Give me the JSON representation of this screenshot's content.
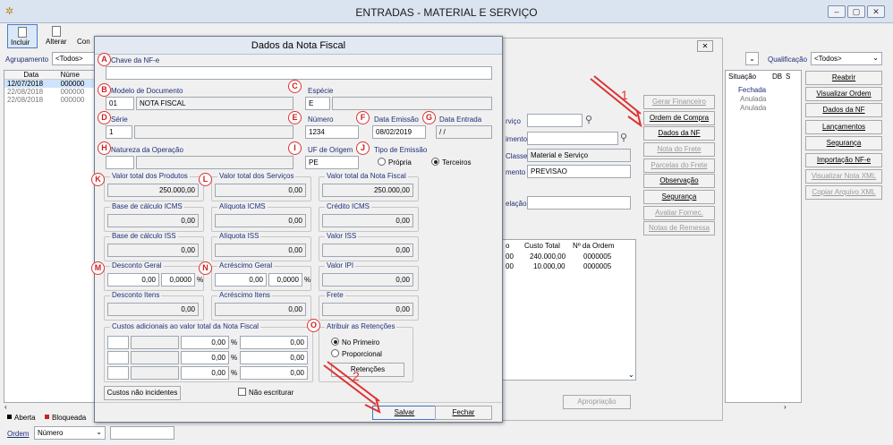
{
  "window": {
    "title": "ENTRADAS - MATERIAL E SERVIÇO",
    "min": "–",
    "max": "▢",
    "close": "✕"
  },
  "toolbar": {
    "incluir": "Incluir",
    "alterar": "Alterar",
    "consultar": "Con"
  },
  "filters": {
    "agrupamento_label": "Agrupamento",
    "agrupamento_value": "<Todos>",
    "qualificacao_label": "Qualificação",
    "qualificacao_value": "<Todos>"
  },
  "main_grid": {
    "headers": [
      "Data",
      "Núme"
    ],
    "rows": [
      [
        "12/07/2018",
        "000000"
      ],
      [
        "22/08/2018",
        "000000"
      ],
      [
        "22/08/2018",
        "000000"
      ]
    ]
  },
  "situacao": {
    "headers": [
      "Situação",
      "DB",
      "S"
    ],
    "rows": [
      "Fechada",
      "Anulada",
      "Anulada"
    ]
  },
  "right_buttons": [
    "Reabrir",
    "Visualizar Ordem",
    "Dados da NF",
    "Lançamentos",
    "Segurança",
    "Importação NF-e",
    "Visualizar Nota XML",
    "Copiar Arquivo XML"
  ],
  "bg_panel": {
    "buttons": [
      "Gerar Financeiro",
      "Ordem de Compra",
      "Dados da NF",
      "Nota do Frete",
      "Parcelas do Frete",
      "Observação",
      "Segurança",
      "Avaliar Fornec.",
      "Notas de Remessa"
    ],
    "labels": [
      "rviço",
      "imento",
      "Classe",
      "mento",
      "elação"
    ],
    "classe_value": "Material e Serviço",
    "doc_value": "PREVISAO",
    "close_x": "✕",
    "grid_headers": [
      "o",
      "Custo Total",
      "Nº da Ordem"
    ],
    "grid_rows": [
      [
        "00",
        "240.000,00",
        "0000005"
      ],
      [
        "00",
        "10.000,00",
        "0000005"
      ]
    ],
    "apropriacao": "Apropriação"
  },
  "legend": {
    "aberta": "Aberta",
    "bloqueada": "Bloqueada"
  },
  "bottom": {
    "ordem_label": "Ordem",
    "ordem_value": "Número"
  },
  "dialog": {
    "title": "Dados da Nota Fiscal",
    "chave_label": "Chave da NF-e",
    "chave_value": "",
    "modelo_label": "Modelo de Documento",
    "modelo_code": "01",
    "modelo_desc": "NOTA FISCAL",
    "especie_label": "Espécie",
    "especie_value": "E",
    "serie_label": "Série",
    "serie_value": "1",
    "numero_label": "Número",
    "numero_value": "1234",
    "emissao_label": "Data Emissão",
    "emissao_value": "08/02/2019",
    "entrada_label": "Data Entrada",
    "entrada_value": " / /",
    "natureza_label": "Natureza da Operação",
    "uf_label": "UF de Origem",
    "uf_value": "PE",
    "tipo_label": "Tipo de Emissão",
    "tipo_propria": "Própria",
    "tipo_terceiros": "Terceiros",
    "vprod_label": "Valor total dos Produtos",
    "vprod": "250.000,00",
    "vserv_label": "Valor total dos Serviços",
    "vserv": "0,00",
    "vnf_label": "Valor total da Nota Fiscal",
    "vnf": "250.000,00",
    "bicms_label": "Base de cálculo ICMS",
    "bicms": "0,00",
    "aicms_label": "Alíquota ICMS",
    "aicms": "0,00",
    "cicms_label": "Crédito ICMS",
    "cicms": "0,00",
    "biss_label": "Base de cálculo ISS",
    "biss": "0,00",
    "aiss_label": "Alíquota ISS",
    "aiss": "0,00",
    "viss_label": "Valor ISS",
    "viss": "0,00",
    "desc_label": "Desconto Geral",
    "desc": "0,00",
    "desc_pct": "0,0000",
    "acr_label": "Acréscimo Geral",
    "acr": "0,00",
    "acr_pct": "0,0000",
    "ipi_label": "Valor IPI",
    "ipi": "0,00",
    "desci_label": "Desconto Itens",
    "desci": "0,00",
    "acri_label": "Acréscimo Itens",
    "acri": "0,00",
    "frete_label": "Frete",
    "frete": "0,00",
    "custos_label": "Custos adicionais ao valor total da Nota Fiscal",
    "custos_rows": [
      [
        "0,00",
        "0,00"
      ],
      [
        "0,00",
        "0,00"
      ],
      [
        "0,00",
        "0,00"
      ]
    ],
    "pct": "%",
    "ret_label": "Atribuir as Retenções",
    "ret_primeiro": "No Primeiro",
    "ret_prop": "Proporcional",
    "ret_btn": "Retenções",
    "custos_btn": "Custos não incidentes",
    "nao_escriturar": "Não escriturar",
    "salvar": "Salvar",
    "fechar": "Fechar"
  },
  "callouts": [
    "A",
    "B",
    "C",
    "D",
    "E",
    "F",
    "G",
    "H",
    "I",
    "J",
    "K",
    "L",
    "M",
    "N",
    "O"
  ],
  "annotations": [
    "1",
    "2"
  ]
}
